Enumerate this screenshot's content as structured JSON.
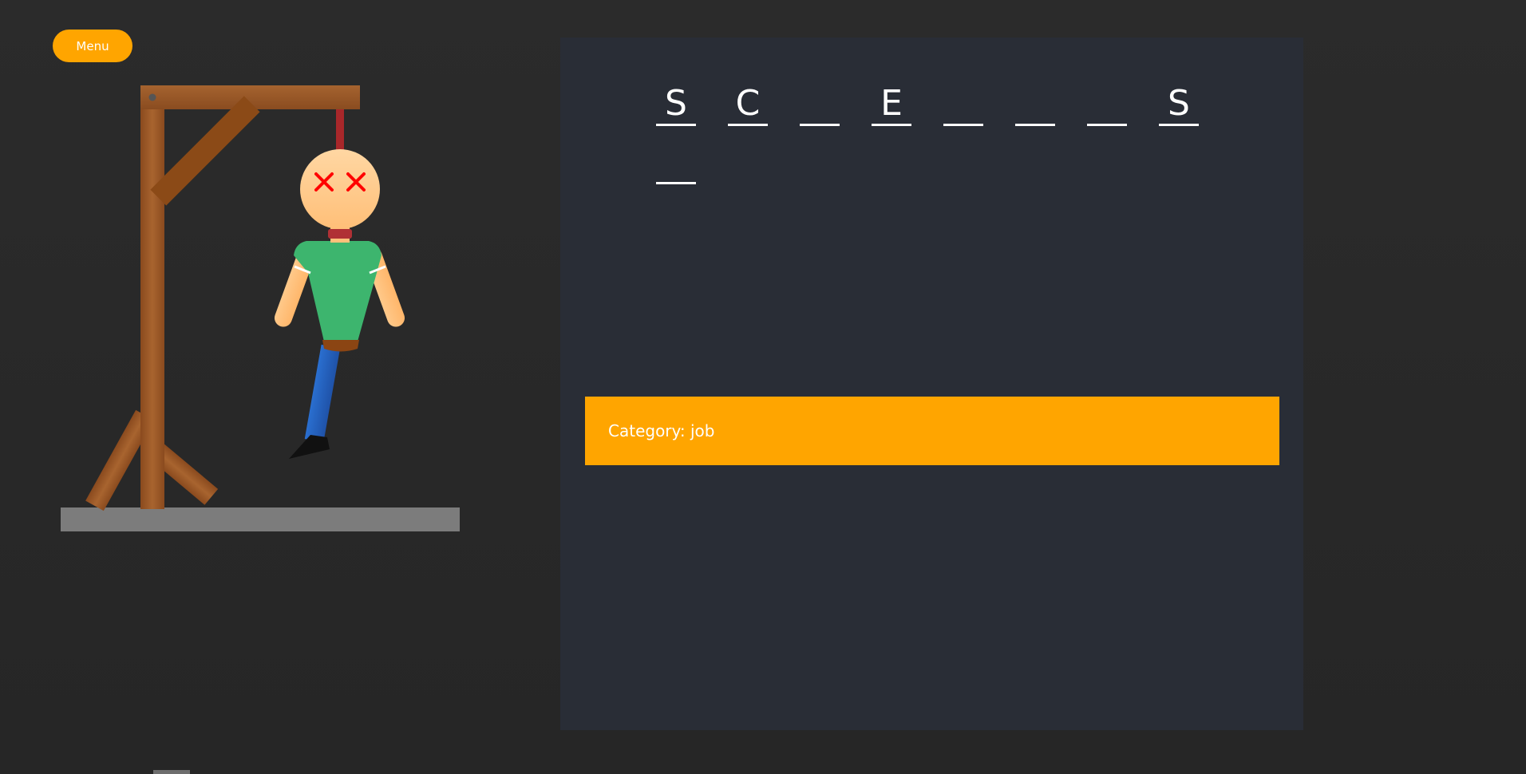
{
  "menu": {
    "label": "Menu"
  },
  "game": {
    "word_slots": [
      "S",
      "C",
      "",
      "E",
      "",
      "",
      "",
      "S",
      ""
    ],
    "category_label": "Category: job"
  },
  "colors": {
    "accent": "#ffa500",
    "panel": "#292d36",
    "background": "#282828",
    "gallows_wood": "#9b5a2b",
    "shirt": "#3db56e",
    "pants": "#2a6fd0",
    "eyes": "#ff0000"
  }
}
